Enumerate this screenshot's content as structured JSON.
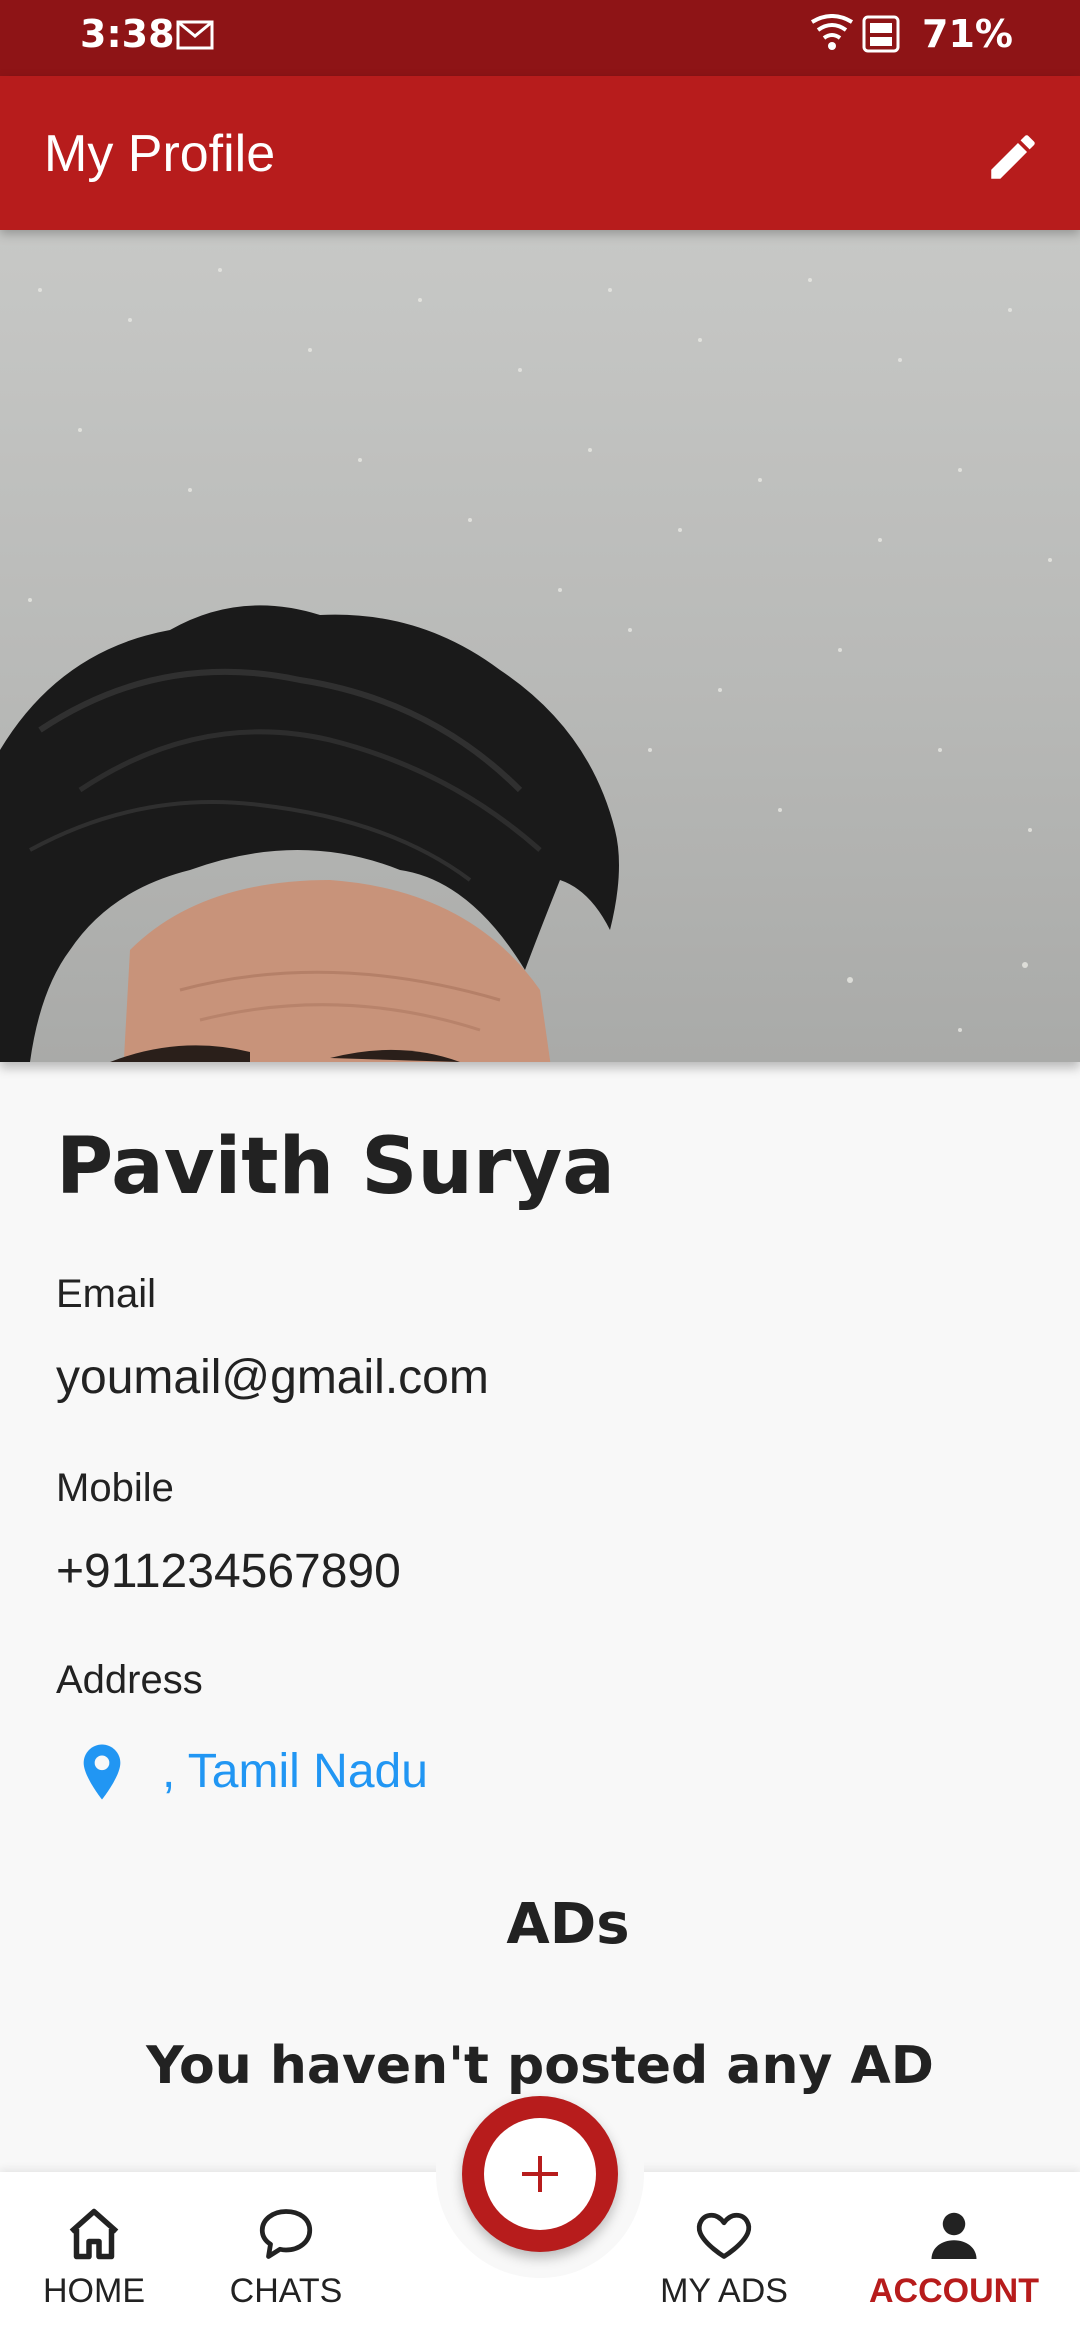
{
  "status_bar": {
    "time": "3:38",
    "battery": "71%",
    "icons": [
      "mail-icon",
      "wifi-icon",
      "volte-icon"
    ]
  },
  "app_bar": {
    "title": "My Profile",
    "edit_icon": "edit-pencil-icon"
  },
  "profile": {
    "name": "Pavith Surya",
    "email_label": "Email",
    "email": "youmail@gmail.com",
    "mobile_label": "Mobile",
    "mobile": "+911234567890",
    "address_label": "Address",
    "address": ", Tamil Nadu"
  },
  "ads": {
    "heading": "ADs",
    "empty_message": "You haven't posted any AD"
  },
  "bottom_nav": {
    "items": [
      {
        "label": "HOME",
        "icon": "home-icon",
        "active": false
      },
      {
        "label": "CHATS",
        "icon": "chat-bubble-icon",
        "active": false
      },
      {
        "label": "MY ADS",
        "icon": "heart-icon",
        "active": false
      },
      {
        "label": "ACCOUNT",
        "icon": "person-icon",
        "active": true
      }
    ],
    "fab_icon": "plus-icon"
  },
  "colors": {
    "status_bar": "#8e1416",
    "app_bar": "#b71c1c",
    "accent": "#b71c1c",
    "link": "#2196f3",
    "background": "#f8f8f8"
  }
}
